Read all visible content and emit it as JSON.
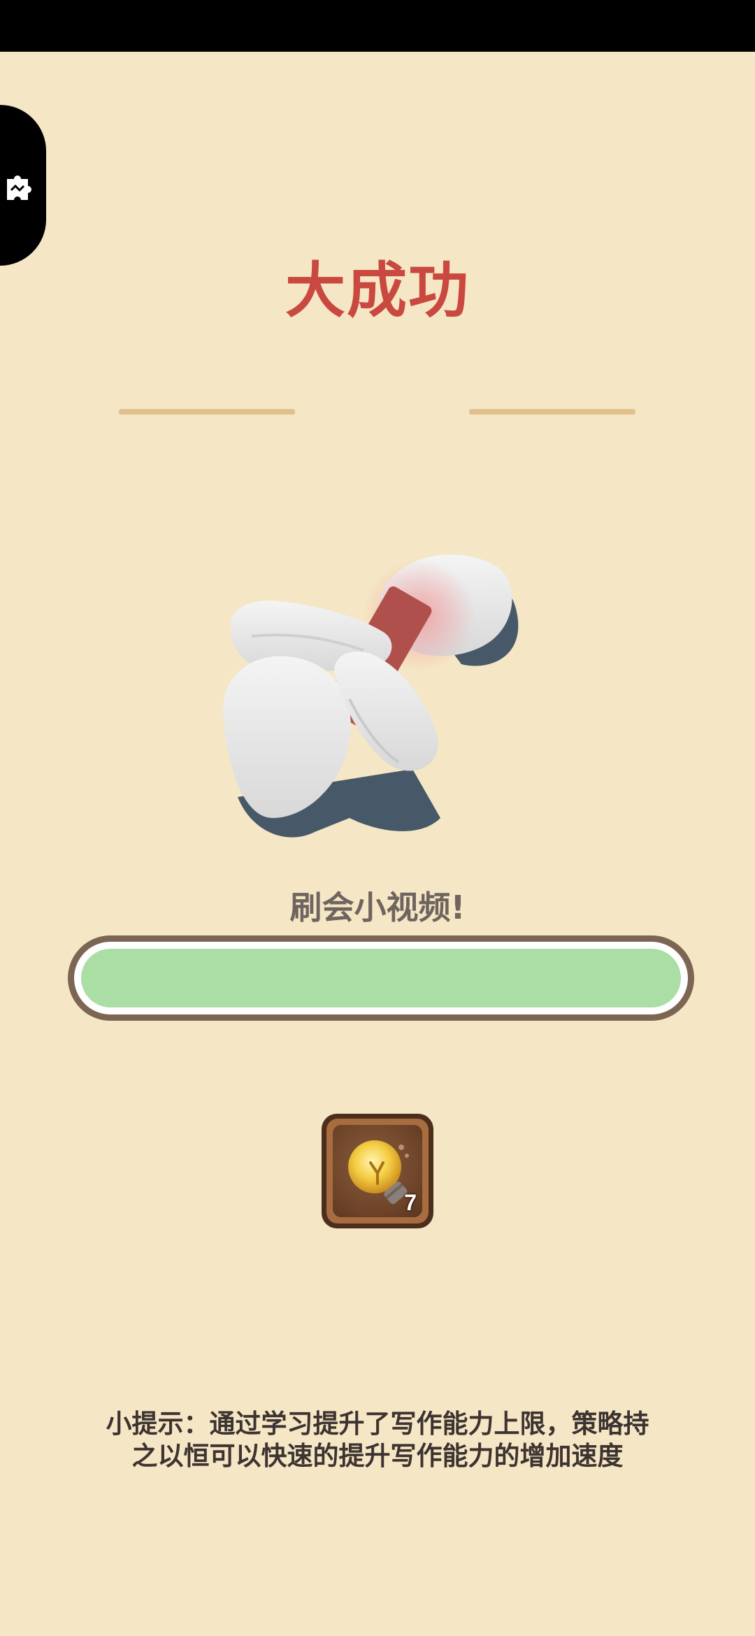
{
  "result": {
    "title": "大成功",
    "activity": "刷会小视频!"
  },
  "progress": {
    "value": 1.0,
    "fill_color": "#abdea5"
  },
  "reward": {
    "icon": "lightbulb-icon",
    "count": "7"
  },
  "hint": {
    "line1": "小提示：通过学习提升了写作能力上限，策略持",
    "line2": "之以恒可以快速的提升写作能力的增加速度"
  },
  "colors": {
    "background": "#f5e6c5",
    "title": "#c9483f",
    "divider": "#e2c08e"
  }
}
